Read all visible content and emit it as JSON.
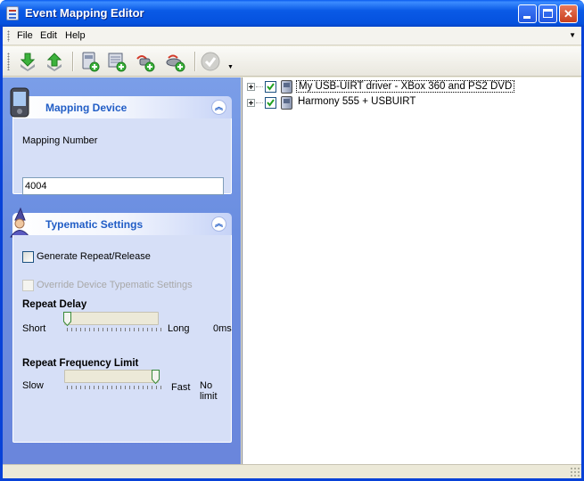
{
  "window": {
    "title": "Event Mapping Editor"
  },
  "menu": {
    "items": [
      "File",
      "Edit",
      "Help"
    ]
  },
  "toolbar": {
    "buttons": [
      "download-icon",
      "upload-icon",
      "add-device-icon",
      "add-device-list-icon",
      "add-remote-icon",
      "add-gamepad-icon",
      "apply-check-icon"
    ]
  },
  "mapping_device": {
    "title": "Mapping Device",
    "number_label": "Mapping Number",
    "number_value": "4004"
  },
  "typematic": {
    "title": "Typematic Settings",
    "generate_label": "Generate Repeat/Release",
    "generate_checked": false,
    "override_label": "Override Device Typematic Settings",
    "override_checked": false,
    "override_enabled": false,
    "repeat_delay": {
      "label": "Repeat Delay",
      "min_label": "Short",
      "max_label": "Long",
      "value_text": "0ms",
      "position": 0.0
    },
    "repeat_frequency": {
      "label": "Repeat Frequency Limit",
      "min_label": "Slow",
      "max_label": "Fast",
      "value_text": "No limit",
      "position": 1.0
    }
  },
  "tree": {
    "items": [
      {
        "label": "My USB-UIRT driver - XBox 360 and PS2 DVD",
        "checked": true,
        "focused": true
      },
      {
        "label": "Harmony 555 + USBUIRT",
        "checked": true,
        "focused": false
      }
    ]
  },
  "colors": {
    "titlebar": "#0a5ae6",
    "pane_background": "#6a8de0",
    "group_title": "#215dc6",
    "group_body": "#d6dff7"
  }
}
